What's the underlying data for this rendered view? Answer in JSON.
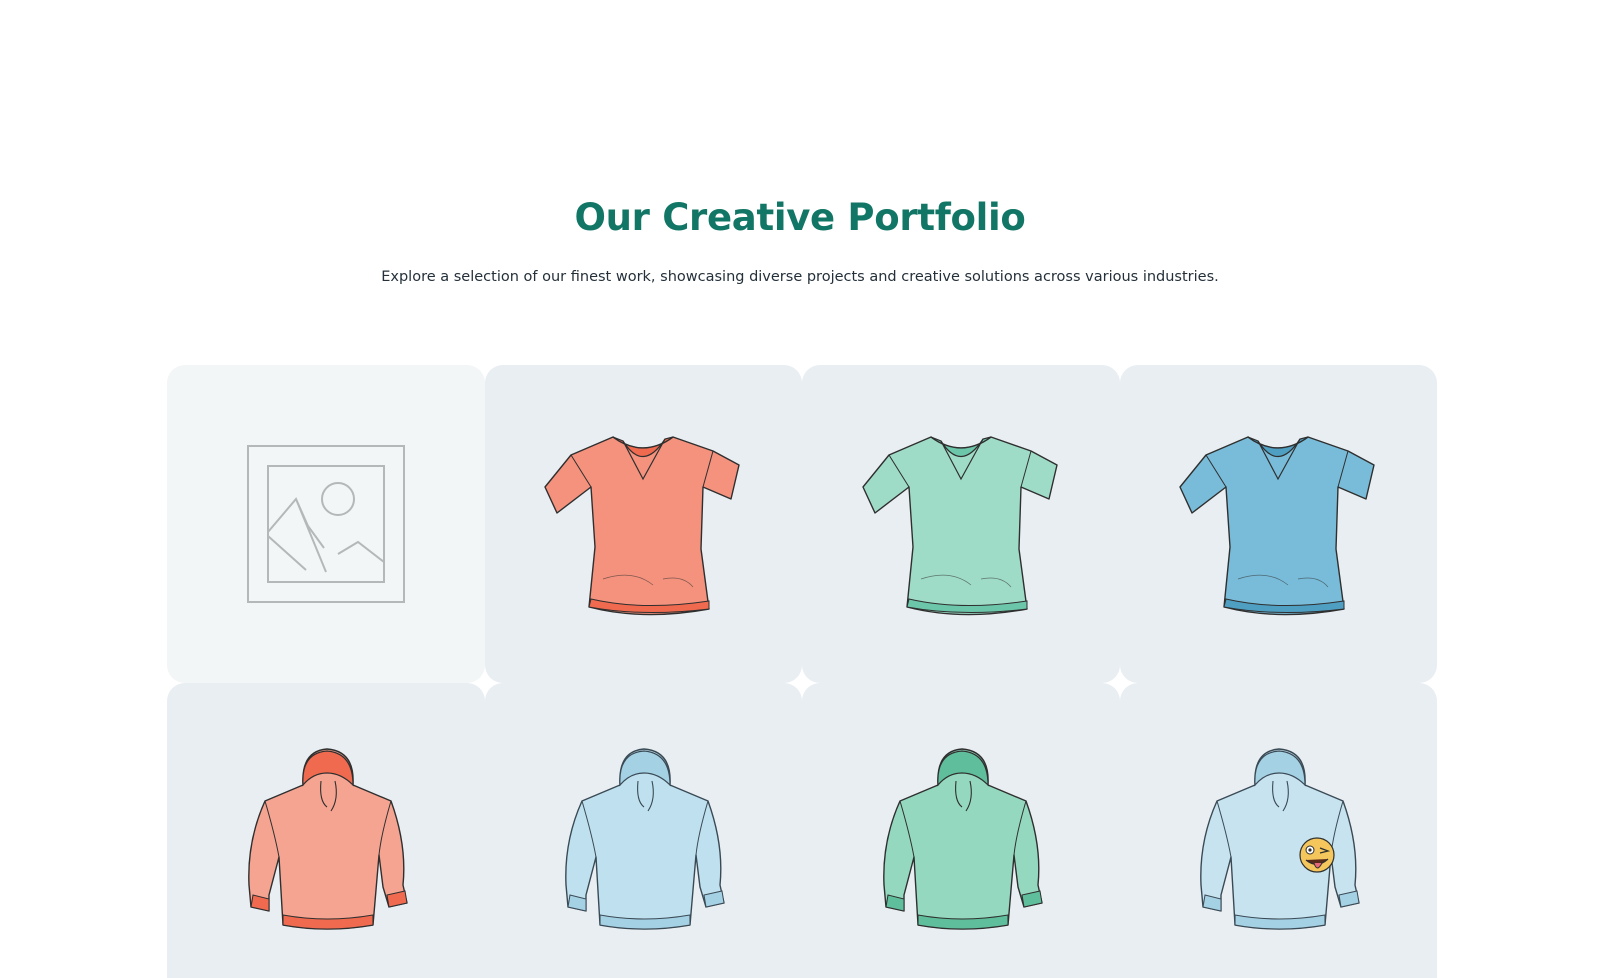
{
  "portfolio": {
    "title": "Our Creative Portfolio",
    "subtitle": "Explore a selection of our finest work, showcasing diverse projects and creative solutions across various industries."
  },
  "items": [
    {
      "kind": "placeholder",
      "icon": "image-placeholder-icon"
    },
    {
      "kind": "tshirt",
      "color": "#f4927d",
      "stroke": "#2f2f2f",
      "accent": "#f06a4f"
    },
    {
      "kind": "tshirt",
      "color": "#9fdcc8",
      "stroke": "#2f2f2f",
      "accent": "#6cc6aa"
    },
    {
      "kind": "tshirt",
      "color": "#79bcd9",
      "stroke": "#2f2f2f",
      "accent": "#4f9fc3"
    },
    {
      "kind": "hoodie",
      "color": "#f5a491",
      "stroke": "#2f2f2f",
      "accent": "#f06a4f"
    },
    {
      "kind": "hoodie",
      "color": "#bfe0ee",
      "stroke": "#3a4a55",
      "accent": "#a5d1e5"
    },
    {
      "kind": "hoodie",
      "color": "#94d9bf",
      "stroke": "#2f2f2f",
      "accent": "#5fbf9c"
    },
    {
      "kind": "hoodie",
      "color": "#c6e3ef",
      "stroke": "#3a4a55",
      "accent": "#a5d1e5",
      "emoji": "winking-tongue-emoji"
    }
  ]
}
